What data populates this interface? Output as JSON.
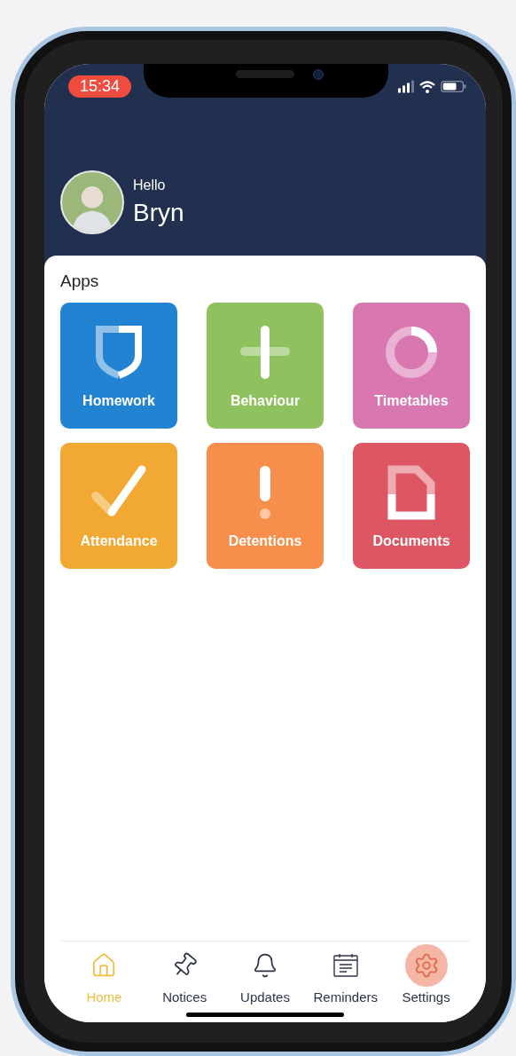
{
  "status_bar": {
    "time": "15:34"
  },
  "header": {
    "greeting": "Hello",
    "name": "Bryn"
  },
  "apps_section": {
    "title": "Apps",
    "apps": [
      {
        "label": "Homework",
        "color": "#2383d3"
      },
      {
        "label": "Behaviour",
        "color": "#8fc25f"
      },
      {
        "label": "Timetables",
        "color": "#d877b0"
      },
      {
        "label": "Attendance",
        "color": "#f2a933"
      },
      {
        "label": "Detentions",
        "color": "#f88e4c"
      },
      {
        "label": "Documents",
        "color": "#dd5663"
      }
    ]
  },
  "tab_bar": [
    {
      "label": "Home",
      "selected": true,
      "highlighted": false
    },
    {
      "label": "Notices",
      "selected": false,
      "highlighted": false
    },
    {
      "label": "Updates",
      "selected": false,
      "highlighted": false
    },
    {
      "label": "Reminders",
      "selected": false,
      "highlighted": false
    },
    {
      "label": "Settings",
      "selected": false,
      "highlighted": true
    }
  ]
}
